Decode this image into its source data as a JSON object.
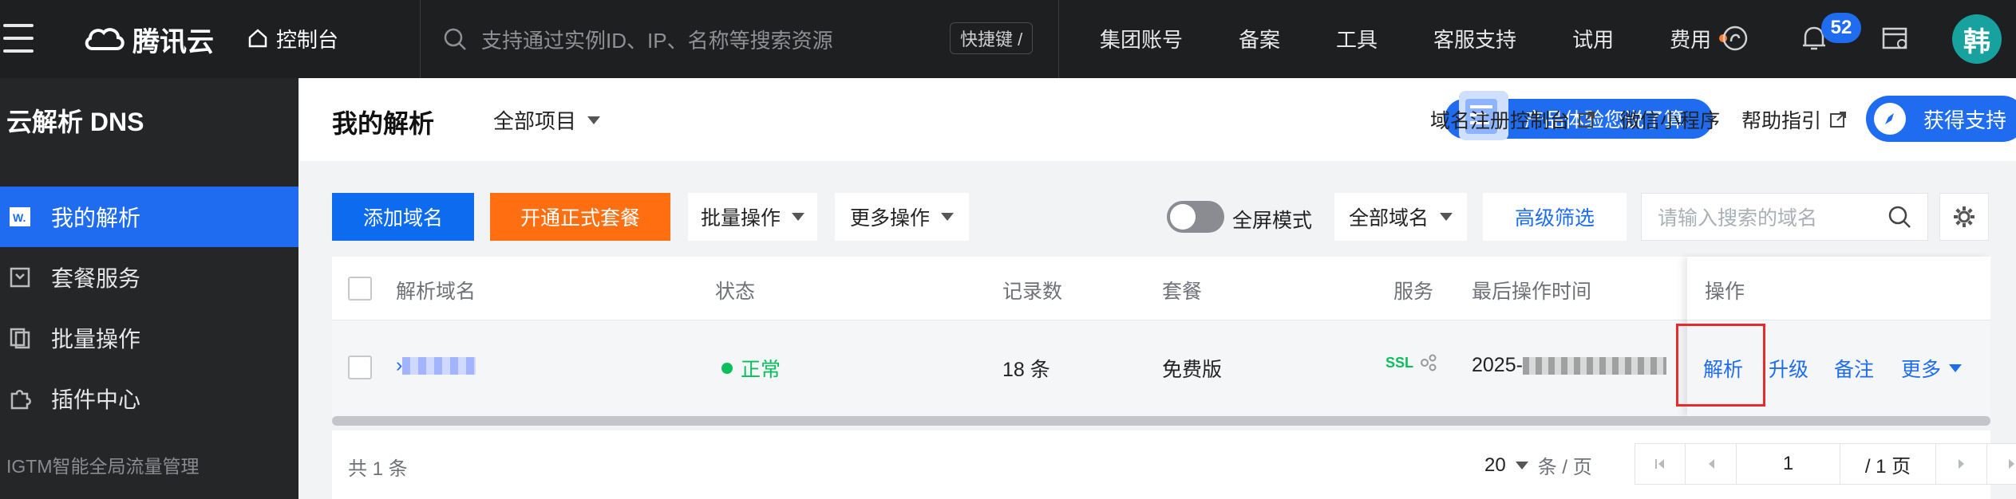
{
  "topbar": {
    "logo_text": "腾讯云",
    "console_label": "控制台",
    "search_placeholder": "支持通过实例ID、IP、名称等搜索资源",
    "shortcut_label": "快捷键 /",
    "nav": [
      "集团账号",
      "备案",
      "工具",
      "客服支持",
      "试用",
      "费用"
    ],
    "notification_count": "52",
    "avatar_text": "韩"
  },
  "sidebar": {
    "title": "云解析 DNS",
    "items": [
      {
        "label": "我的解析",
        "icon": "w-doc-icon",
        "active": true
      },
      {
        "label": "套餐服务",
        "icon": "package-icon",
        "active": false
      },
      {
        "label": "批量操作",
        "icon": "copy-icon",
        "active": false
      },
      {
        "label": "插件中心",
        "icon": "puzzle-icon",
        "active": false
      }
    ],
    "footer_text": "IGTM智能全局流量管理"
  },
  "header": {
    "title": "我的解析",
    "project_selector": "全部项目",
    "promo_label": "产品体验您说了算",
    "links": [
      "域名注册控制台",
      "微信小程序",
      "帮助指引"
    ],
    "support_label": "获得支持"
  },
  "toolbar": {
    "add_domain": "添加域名",
    "open_package": "开通正式套餐",
    "batch_ops": "批量操作",
    "more_ops": "更多操作",
    "fullscreen_label": "全屏模式",
    "domain_filter": "全部域名",
    "advanced_filter": "高级筛选",
    "search_placeholder": "请输入搜索的域名"
  },
  "table": {
    "headers": [
      "解析域名",
      "状态",
      "记录数",
      "套餐",
      "服务",
      "最后操作时间",
      "操作"
    ],
    "rows": [
      {
        "status": "正常",
        "records": "18 条",
        "plan": "免费版",
        "service": "SSL",
        "last_op_prefix": "2025-",
        "actions": [
          "解析",
          "升级",
          "备注",
          "更多"
        ]
      }
    ]
  },
  "footer": {
    "total": "共 1 条",
    "page_size": "20",
    "page_size_unit": "条 / 页",
    "current_page": "1",
    "total_pages": "/ 1 页"
  },
  "colors": {
    "primary": "#1f6cf0",
    "orange": "#ff6e10",
    "status_ok": "#0abf5b",
    "highlight_box": "#e52b2b"
  }
}
